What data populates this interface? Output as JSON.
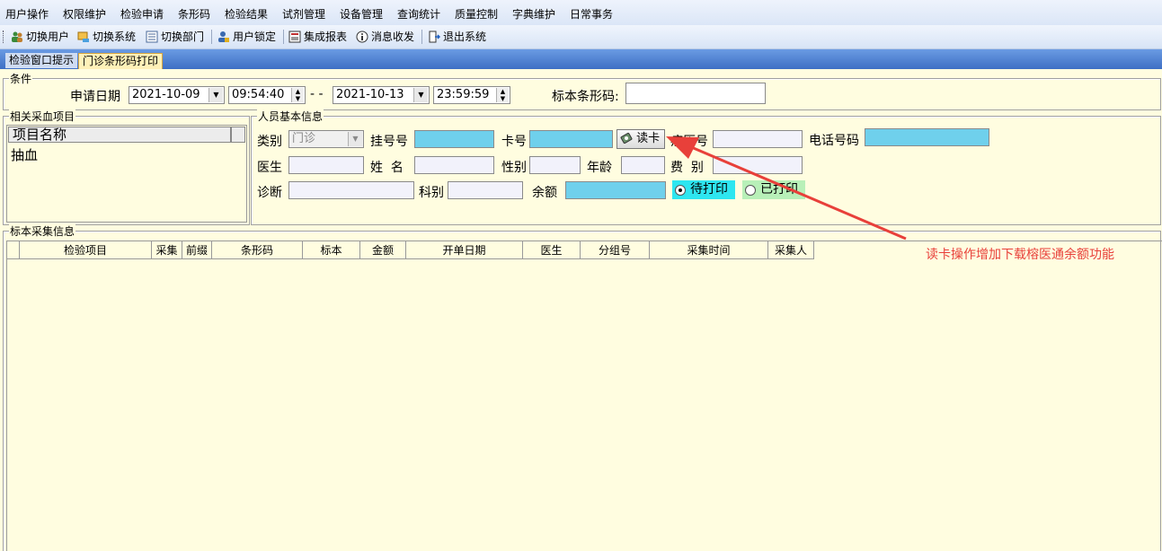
{
  "menu": {
    "items": [
      "用户操作",
      "权限维护",
      "检验申请",
      "条形码",
      "检验结果",
      "试剂管理",
      "设备管理",
      "查询统计",
      "质量控制",
      "字典维护",
      "日常事务"
    ]
  },
  "toolbar": {
    "switch_user": "切换用户",
    "switch_system": "切换系统",
    "switch_dept": "切换部门",
    "user_lock": "用户锁定",
    "integrated_report": "集成报表",
    "messages": "消息收发",
    "exit_system": "退出系统"
  },
  "tabs": [
    "检验窗口提示",
    "门诊条形码打印"
  ],
  "conditions": {
    "legend": "条件",
    "apply_date_label": "申请日期",
    "start_date": "2021-10-09",
    "start_time": "09:54:40",
    "range_sep": "- -",
    "end_date": "2021-10-13",
    "end_time": "23:59:59",
    "barcode_label": "标本条形码:",
    "barcode_value": ""
  },
  "related_items": {
    "legend": "相关采血项目",
    "header": "项目名称",
    "rows": [
      "抽血"
    ]
  },
  "person": {
    "legend": "人员基本信息",
    "category_label": "类别",
    "category_value": "门诊",
    "register_no_label": "挂号号",
    "card_no_label": "卡号",
    "read_card_button": "读卡",
    "record_no_label": "病历号",
    "phone_label": "电话号码",
    "doctor_label": "医生",
    "name_label": "姓  名",
    "gender_label": "性别",
    "age_label": "年龄",
    "fee_label": "费  别",
    "diagnosis_label": "诊断",
    "department_label": "科别",
    "balance_label": "余额",
    "radio_pending": "待打印",
    "radio_printed": "已打印"
  },
  "collection": {
    "legend": "标本采集信息",
    "columns": [
      "检验项目",
      "采集",
      "前缀",
      "条形码",
      "标本",
      "金额",
      "开单日期",
      "医生",
      "分组号",
      "采集时间",
      "采集人"
    ]
  },
  "annotation": {
    "text": "读卡操作增加下载榕医通余额功能",
    "color": "#e8403a"
  },
  "colors": {
    "background": "#fffde0",
    "cyan_field": "#6fd0ec",
    "tab_strip": "#3e6fc4"
  }
}
